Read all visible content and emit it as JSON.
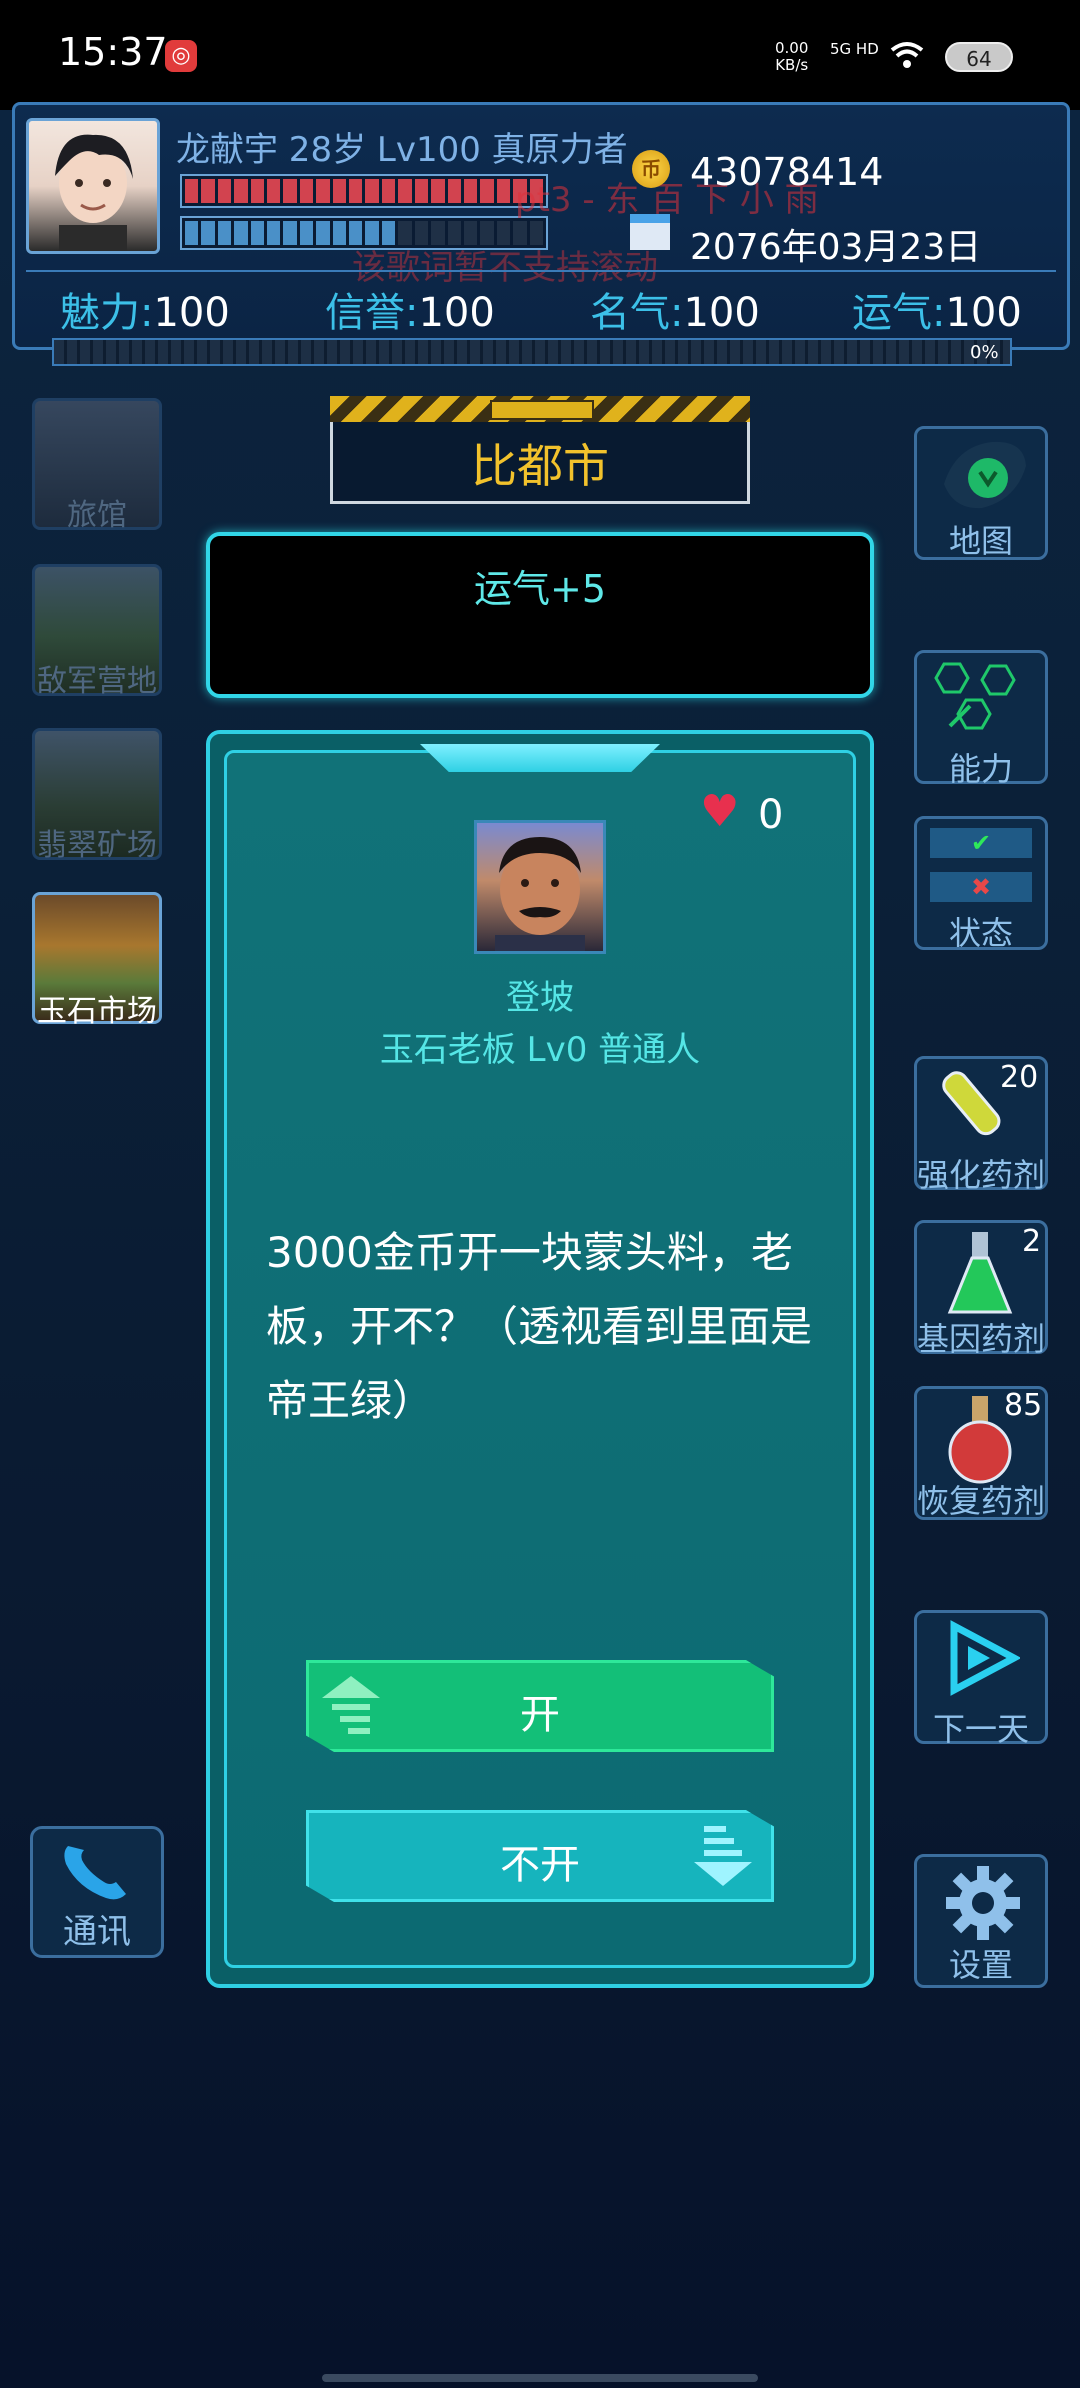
{
  "status_bar": {
    "time": "15:37",
    "net_speed_value": "0.00",
    "net_speed_unit": "KB/s",
    "network": "5G HD",
    "battery": "64"
  },
  "player": {
    "info": "龙献宇 28岁 Lv100 真原力者",
    "hp_fraction": 1.0,
    "mp_fraction": 0.6,
    "gold": "43078414",
    "date": "2076年03月23日",
    "stats": [
      {
        "key": "魅力",
        "value": "100"
      },
      {
        "key": "信誉",
        "value": "100"
      },
      {
        "key": "名气",
        "value": "100"
      },
      {
        "key": "运气",
        "value": "100"
      }
    ],
    "exp_percent": "0%"
  },
  "overlay_lyrics": {
    "line1": "pt3 - 东 百 下 小 雨",
    "line2": "该歌词暂不支持滚动"
  },
  "locations": [
    {
      "label": "旅馆",
      "active": false
    },
    {
      "label": "敌军营地",
      "active": false
    },
    {
      "label": "翡翠矿场",
      "active": false
    },
    {
      "label": "玉石市场",
      "active": true
    }
  ],
  "city": "比都市",
  "message": "运气+5",
  "event": {
    "affection": "0",
    "npc_name": "登坡",
    "npc_title": "玉石老板 Lv0 普通人",
    "dialogue": "3000金币开一块蒙头料，老板，开不？（透视看到里面是帝王绿）",
    "choice_yes": "开",
    "choice_no": "不开"
  },
  "right_menu": {
    "map": "地图",
    "ability": "能力",
    "status": "状态",
    "potion_strength": {
      "label": "强化药剂",
      "count": "20"
    },
    "potion_gene": {
      "label": "基因药剂",
      "count": "2"
    },
    "potion_heal": {
      "label": "恢复药剂",
      "count": "85"
    },
    "next_day": "下一天",
    "settings": "设置"
  },
  "comm": "通讯",
  "colors": {
    "accent_cyan": "#2fd0e4",
    "gold": "#f2c22c",
    "hp": "#d2434f",
    "mp": "#4a90c8",
    "choice_yes": "#13bf78",
    "choice_no": "#16b4bd"
  }
}
